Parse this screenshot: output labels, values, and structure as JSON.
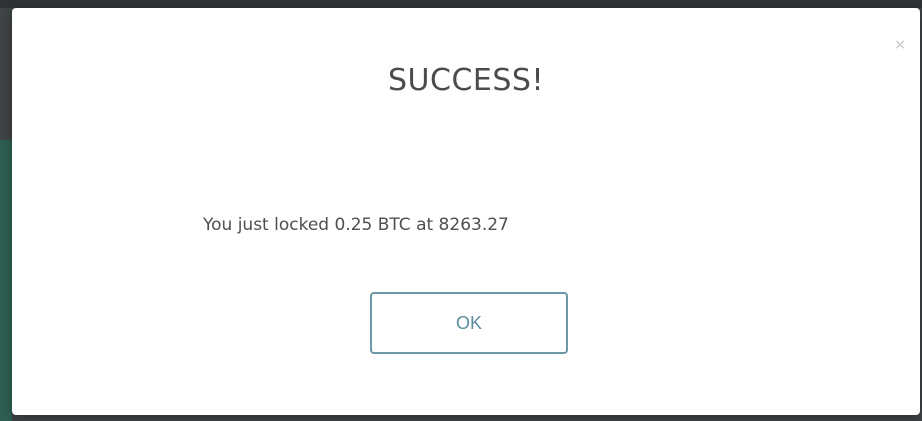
{
  "modal": {
    "title": "SUCCESS!",
    "message": "You just locked 0.25 BTC at 8263.27",
    "ok_label": "OK",
    "close_glyph": "×"
  },
  "icons": {
    "close": "close-icon"
  },
  "colors": {
    "title_text": "#4b4b4b",
    "button_border": "#6e98a8",
    "button_text": "#5d8ea1",
    "backdrop": "#3f4446"
  }
}
